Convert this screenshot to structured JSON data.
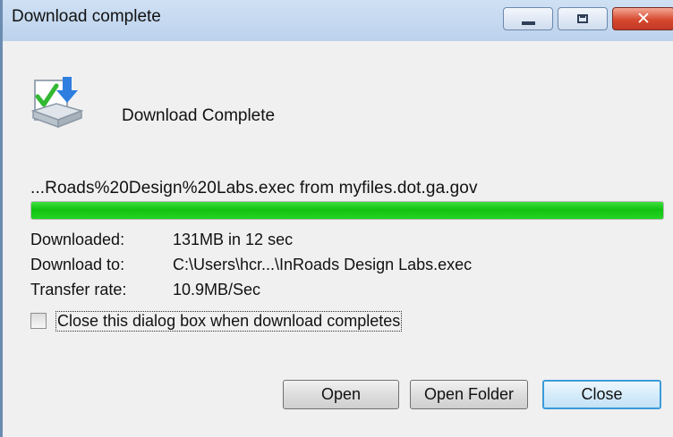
{
  "window": {
    "title": "Download complete",
    "controls": {
      "minimize_icon": "minimize-icon",
      "maximize_icon": "maximize-icon",
      "close_glyph": "✕"
    }
  },
  "header": {
    "icon": "download-complete-icon",
    "heading": "Download Complete"
  },
  "download": {
    "file_source": "...Roads%20Design%20Labs.exec from myfiles.dot.ga.gov",
    "progress": 1.0,
    "progress_color": "#1cc81c",
    "details": [
      {
        "label": "Downloaded:",
        "value": "131MB in 12 sec"
      },
      {
        "label": "Download to:",
        "value": "C:\\Users\\hcr...\\InRoads Design Labs.exec"
      },
      {
        "label": "Transfer rate:",
        "value": "10.9MB/Sec"
      }
    ]
  },
  "options": {
    "close_when_complete_label": "Close this dialog box when download completes",
    "close_when_complete_checked": false
  },
  "buttons": {
    "open_label": "Open",
    "open_folder_label": "Open Folder",
    "close_label": "Close"
  },
  "colors": {
    "titlebar": "#c4d7ee",
    "close_button": "#d6482f",
    "default_button_border": "#3c9bd9",
    "dialog_background": "#f0f0f0"
  }
}
